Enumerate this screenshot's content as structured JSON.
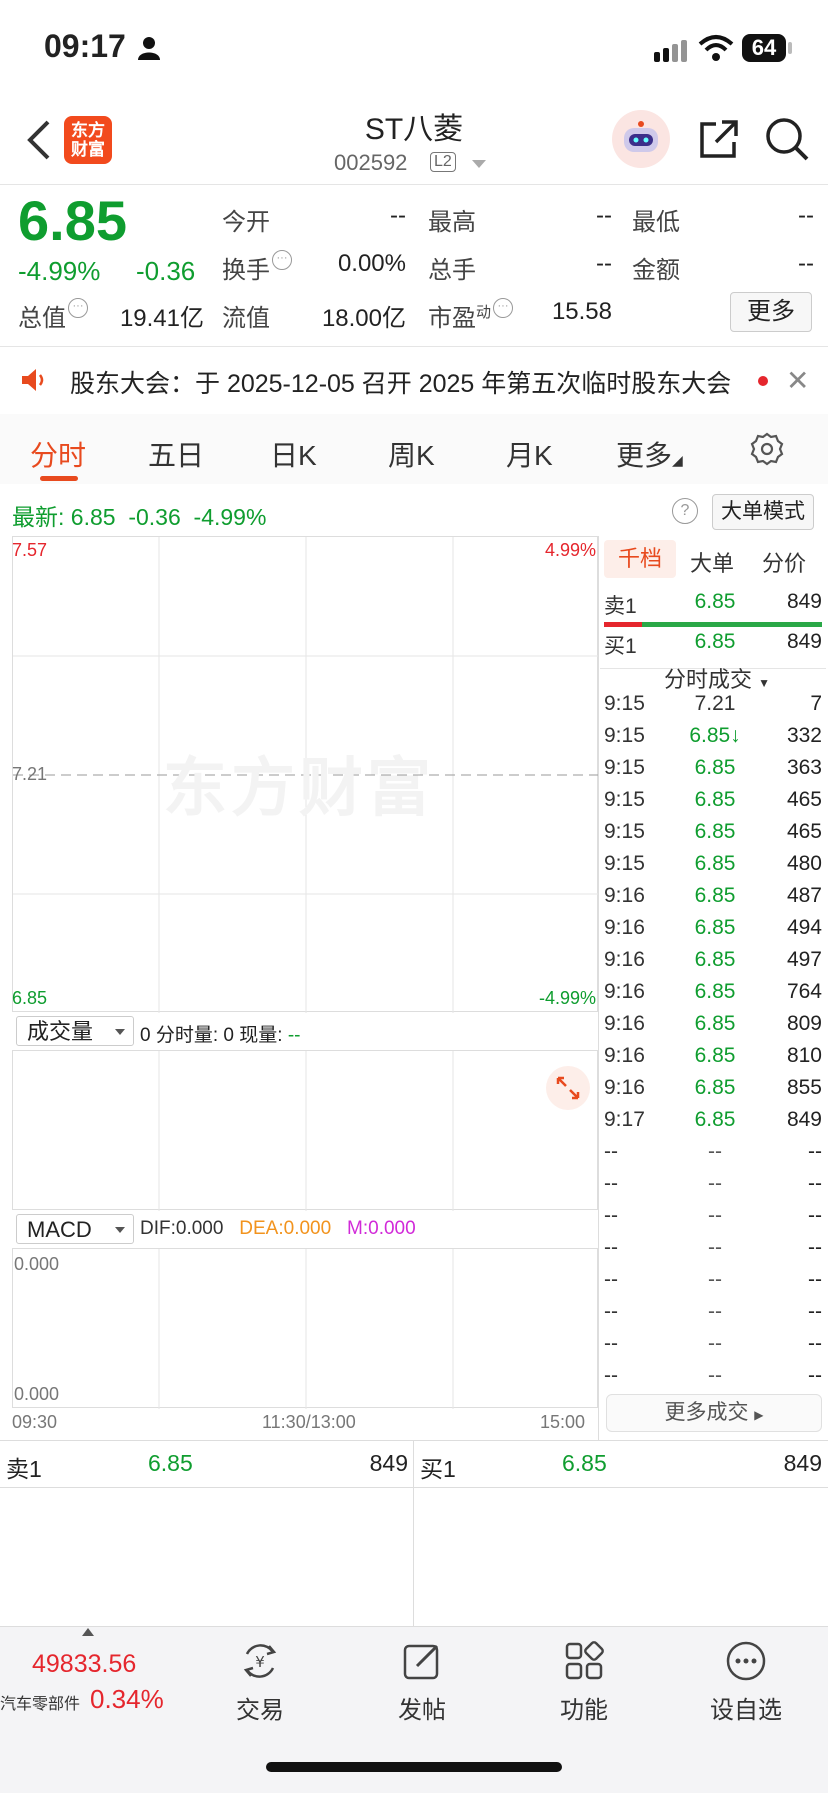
{
  "status_bar": {
    "time": "09:17",
    "battery": "64"
  },
  "header": {
    "name": "ST八菱",
    "code": "002592",
    "level_badge": "L2",
    "logo_text": [
      "东方",
      "财富"
    ]
  },
  "quote": {
    "price": "6.85",
    "change_pct": "-4.99%",
    "change": "-0.36",
    "open_label": "今开",
    "open": "--",
    "high_label": "最高",
    "high": "--",
    "low_label": "最低",
    "low": "--",
    "turnover_label": "换手",
    "turnover": "0.00%",
    "volume_label": "总手",
    "volume": "--",
    "amount_label": "金额",
    "amount": "--",
    "total_cap_label": "总值",
    "total_cap": "19.41亿",
    "float_cap_label": "流值",
    "float_cap": "18.00亿",
    "pe_label": "市盈",
    "pe_sup": "动",
    "pe": "15.58",
    "more_label": "更多"
  },
  "notice": {
    "text": "股东大会：于 2025-12-05 召开 2025 年第五次临时股东大会"
  },
  "tabs": [
    "分时",
    "五日",
    "日K",
    "周K",
    "月K",
    "更多"
  ],
  "latest": {
    "label": "最新:",
    "price": "6.85",
    "change": "-0.36",
    "pct": "-4.99%"
  },
  "big_order_mode": "大单模式",
  "chart": {
    "y_top": "7.57",
    "y_mid": "7.21",
    "y_bottom": "6.85",
    "pct_top": "4.99%",
    "pct_bottom": "-4.99%",
    "watermark": "东方财富",
    "x_start": "09:30",
    "x_mid": "11:30/13:00",
    "x_end": "15:00"
  },
  "volume_panel": {
    "selector": "成交量",
    "info": "0 分时量: 0 现量: ",
    "current": "--"
  },
  "macd_panel": {
    "selector": "MACD",
    "dif": "DIF:0.000",
    "dea": "DEA:0.000",
    "m": "M:0.000",
    "top": "0.000",
    "bottom": "0.000"
  },
  "side": {
    "tabs": [
      "千档",
      "大单",
      "分价"
    ],
    "sell1": {
      "label": "卖1",
      "price": "6.85",
      "vol": "849"
    },
    "buy1": {
      "label": "买1",
      "price": "6.85",
      "vol": "849"
    },
    "trades_title": "分时成交",
    "trades": [
      {
        "t": "9:15",
        "p": "7.21",
        "v": "7"
      },
      {
        "t": "9:15",
        "p": "6.85↓",
        "v": "332"
      },
      {
        "t": "9:15",
        "p": "6.85",
        "v": "363"
      },
      {
        "t": "9:15",
        "p": "6.85",
        "v": "465"
      },
      {
        "t": "9:15",
        "p": "6.85",
        "v": "465"
      },
      {
        "t": "9:15",
        "p": "6.85",
        "v": "480"
      },
      {
        "t": "9:16",
        "p": "6.85",
        "v": "487"
      },
      {
        "t": "9:16",
        "p": "6.85",
        "v": "494"
      },
      {
        "t": "9:16",
        "p": "6.85",
        "v": "497"
      },
      {
        "t": "9:16",
        "p": "6.85",
        "v": "764"
      },
      {
        "t": "9:16",
        "p": "6.85",
        "v": "809"
      },
      {
        "t": "9:16",
        "p": "6.85",
        "v": "810"
      },
      {
        "t": "9:16",
        "p": "6.85",
        "v": "855"
      },
      {
        "t": "9:17",
        "p": "6.85",
        "v": "849"
      },
      {
        "t": "--",
        "p": "--",
        "v": "--"
      },
      {
        "t": "--",
        "p": "--",
        "v": "--"
      },
      {
        "t": "--",
        "p": "--",
        "v": "--"
      },
      {
        "t": "--",
        "p": "--",
        "v": "--"
      },
      {
        "t": "--",
        "p": "--",
        "v": "--"
      },
      {
        "t": "--",
        "p": "--",
        "v": "--"
      },
      {
        "t": "--",
        "p": "--",
        "v": "--"
      },
      {
        "t": "--",
        "p": "--",
        "v": "--"
      }
    ],
    "more_trades": "更多成交"
  },
  "book": {
    "sell1_label": "卖1",
    "sell1_price": "6.85",
    "sell1_vol": "849",
    "buy1_label": "买1",
    "buy1_price": "6.85",
    "buy1_vol": "849"
  },
  "tabbar": {
    "index_value": "49833.56",
    "index_name": "汽车零部件",
    "index_pct": "0.34%",
    "items": [
      "交易",
      "发帖",
      "功能",
      "设自选"
    ]
  }
}
